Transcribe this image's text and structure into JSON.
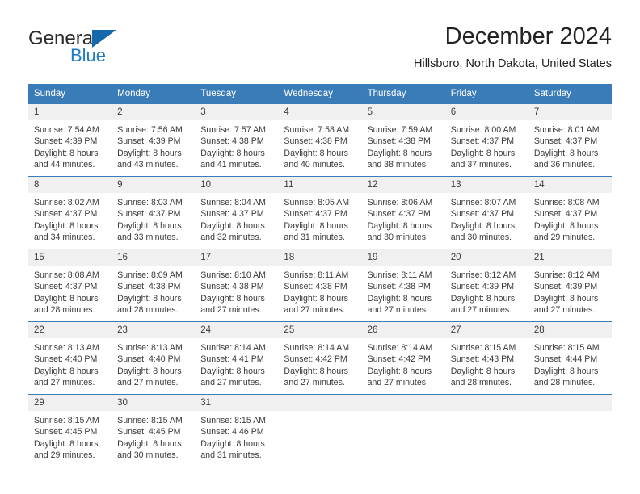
{
  "brand": {
    "name_part1": "General",
    "name_part2": "Blue",
    "flag_icon": "triangle-flag-icon"
  },
  "header": {
    "title": "December 2024",
    "subtitle": "Hillsboro, North Dakota, United States"
  },
  "colors": {
    "header_blue": "#3a7cb8",
    "brand_blue": "#1f7bc1",
    "daynum_band": "#f0f0f0",
    "text": "#3a3a3a"
  },
  "weekday_headers": [
    "Sunday",
    "Monday",
    "Tuesday",
    "Wednesday",
    "Thursday",
    "Friday",
    "Saturday"
  ],
  "weeks": [
    [
      {
        "day": "1",
        "sunrise": "Sunrise: 7:54 AM",
        "sunset": "Sunset: 4:39 PM",
        "daylight_line1": "Daylight: 8 hours",
        "daylight_line2": "and 44 minutes."
      },
      {
        "day": "2",
        "sunrise": "Sunrise: 7:56 AM",
        "sunset": "Sunset: 4:39 PM",
        "daylight_line1": "Daylight: 8 hours",
        "daylight_line2": "and 43 minutes."
      },
      {
        "day": "3",
        "sunrise": "Sunrise: 7:57 AM",
        "sunset": "Sunset: 4:38 PM",
        "daylight_line1": "Daylight: 8 hours",
        "daylight_line2": "and 41 minutes."
      },
      {
        "day": "4",
        "sunrise": "Sunrise: 7:58 AM",
        "sunset": "Sunset: 4:38 PM",
        "daylight_line1": "Daylight: 8 hours",
        "daylight_line2": "and 40 minutes."
      },
      {
        "day": "5",
        "sunrise": "Sunrise: 7:59 AM",
        "sunset": "Sunset: 4:38 PM",
        "daylight_line1": "Daylight: 8 hours",
        "daylight_line2": "and 38 minutes."
      },
      {
        "day": "6",
        "sunrise": "Sunrise: 8:00 AM",
        "sunset": "Sunset: 4:37 PM",
        "daylight_line1": "Daylight: 8 hours",
        "daylight_line2": "and 37 minutes."
      },
      {
        "day": "7",
        "sunrise": "Sunrise: 8:01 AM",
        "sunset": "Sunset: 4:37 PM",
        "daylight_line1": "Daylight: 8 hours",
        "daylight_line2": "and 36 minutes."
      }
    ],
    [
      {
        "day": "8",
        "sunrise": "Sunrise: 8:02 AM",
        "sunset": "Sunset: 4:37 PM",
        "daylight_line1": "Daylight: 8 hours",
        "daylight_line2": "and 34 minutes."
      },
      {
        "day": "9",
        "sunrise": "Sunrise: 8:03 AM",
        "sunset": "Sunset: 4:37 PM",
        "daylight_line1": "Daylight: 8 hours",
        "daylight_line2": "and 33 minutes."
      },
      {
        "day": "10",
        "sunrise": "Sunrise: 8:04 AM",
        "sunset": "Sunset: 4:37 PM",
        "daylight_line1": "Daylight: 8 hours",
        "daylight_line2": "and 32 minutes."
      },
      {
        "day": "11",
        "sunrise": "Sunrise: 8:05 AM",
        "sunset": "Sunset: 4:37 PM",
        "daylight_line1": "Daylight: 8 hours",
        "daylight_line2": "and 31 minutes."
      },
      {
        "day": "12",
        "sunrise": "Sunrise: 8:06 AM",
        "sunset": "Sunset: 4:37 PM",
        "daylight_line1": "Daylight: 8 hours",
        "daylight_line2": "and 30 minutes."
      },
      {
        "day": "13",
        "sunrise": "Sunrise: 8:07 AM",
        "sunset": "Sunset: 4:37 PM",
        "daylight_line1": "Daylight: 8 hours",
        "daylight_line2": "and 30 minutes."
      },
      {
        "day": "14",
        "sunrise": "Sunrise: 8:08 AM",
        "sunset": "Sunset: 4:37 PM",
        "daylight_line1": "Daylight: 8 hours",
        "daylight_line2": "and 29 minutes."
      }
    ],
    [
      {
        "day": "15",
        "sunrise": "Sunrise: 8:08 AM",
        "sunset": "Sunset: 4:37 PM",
        "daylight_line1": "Daylight: 8 hours",
        "daylight_line2": "and 28 minutes."
      },
      {
        "day": "16",
        "sunrise": "Sunrise: 8:09 AM",
        "sunset": "Sunset: 4:38 PM",
        "daylight_line1": "Daylight: 8 hours",
        "daylight_line2": "and 28 minutes."
      },
      {
        "day": "17",
        "sunrise": "Sunrise: 8:10 AM",
        "sunset": "Sunset: 4:38 PM",
        "daylight_line1": "Daylight: 8 hours",
        "daylight_line2": "and 27 minutes."
      },
      {
        "day": "18",
        "sunrise": "Sunrise: 8:11 AM",
        "sunset": "Sunset: 4:38 PM",
        "daylight_line1": "Daylight: 8 hours",
        "daylight_line2": "and 27 minutes."
      },
      {
        "day": "19",
        "sunrise": "Sunrise: 8:11 AM",
        "sunset": "Sunset: 4:38 PM",
        "daylight_line1": "Daylight: 8 hours",
        "daylight_line2": "and 27 minutes."
      },
      {
        "day": "20",
        "sunrise": "Sunrise: 8:12 AM",
        "sunset": "Sunset: 4:39 PM",
        "daylight_line1": "Daylight: 8 hours",
        "daylight_line2": "and 27 minutes."
      },
      {
        "day": "21",
        "sunrise": "Sunrise: 8:12 AM",
        "sunset": "Sunset: 4:39 PM",
        "daylight_line1": "Daylight: 8 hours",
        "daylight_line2": "and 27 minutes."
      }
    ],
    [
      {
        "day": "22",
        "sunrise": "Sunrise: 8:13 AM",
        "sunset": "Sunset: 4:40 PM",
        "daylight_line1": "Daylight: 8 hours",
        "daylight_line2": "and 27 minutes."
      },
      {
        "day": "23",
        "sunrise": "Sunrise: 8:13 AM",
        "sunset": "Sunset: 4:40 PM",
        "daylight_line1": "Daylight: 8 hours",
        "daylight_line2": "and 27 minutes."
      },
      {
        "day": "24",
        "sunrise": "Sunrise: 8:14 AM",
        "sunset": "Sunset: 4:41 PM",
        "daylight_line1": "Daylight: 8 hours",
        "daylight_line2": "and 27 minutes."
      },
      {
        "day": "25",
        "sunrise": "Sunrise: 8:14 AM",
        "sunset": "Sunset: 4:42 PM",
        "daylight_line1": "Daylight: 8 hours",
        "daylight_line2": "and 27 minutes."
      },
      {
        "day": "26",
        "sunrise": "Sunrise: 8:14 AM",
        "sunset": "Sunset: 4:42 PM",
        "daylight_line1": "Daylight: 8 hours",
        "daylight_line2": "and 27 minutes."
      },
      {
        "day": "27",
        "sunrise": "Sunrise: 8:15 AM",
        "sunset": "Sunset: 4:43 PM",
        "daylight_line1": "Daylight: 8 hours",
        "daylight_line2": "and 28 minutes."
      },
      {
        "day": "28",
        "sunrise": "Sunrise: 8:15 AM",
        "sunset": "Sunset: 4:44 PM",
        "daylight_line1": "Daylight: 8 hours",
        "daylight_line2": "and 28 minutes."
      }
    ],
    [
      {
        "day": "29",
        "sunrise": "Sunrise: 8:15 AM",
        "sunset": "Sunset: 4:45 PM",
        "daylight_line1": "Daylight: 8 hours",
        "daylight_line2": "and 29 minutes."
      },
      {
        "day": "30",
        "sunrise": "Sunrise: 8:15 AM",
        "sunset": "Sunset: 4:45 PM",
        "daylight_line1": "Daylight: 8 hours",
        "daylight_line2": "and 30 minutes."
      },
      {
        "day": "31",
        "sunrise": "Sunrise: 8:15 AM",
        "sunset": "Sunset: 4:46 PM",
        "daylight_line1": "Daylight: 8 hours",
        "daylight_line2": "and 31 minutes."
      },
      {
        "day": "",
        "sunrise": "",
        "sunset": "",
        "daylight_line1": "",
        "daylight_line2": ""
      },
      {
        "day": "",
        "sunrise": "",
        "sunset": "",
        "daylight_line1": "",
        "daylight_line2": ""
      },
      {
        "day": "",
        "sunrise": "",
        "sunset": "",
        "daylight_line1": "",
        "daylight_line2": ""
      },
      {
        "day": "",
        "sunrise": "",
        "sunset": "",
        "daylight_line1": "",
        "daylight_line2": ""
      }
    ]
  ]
}
